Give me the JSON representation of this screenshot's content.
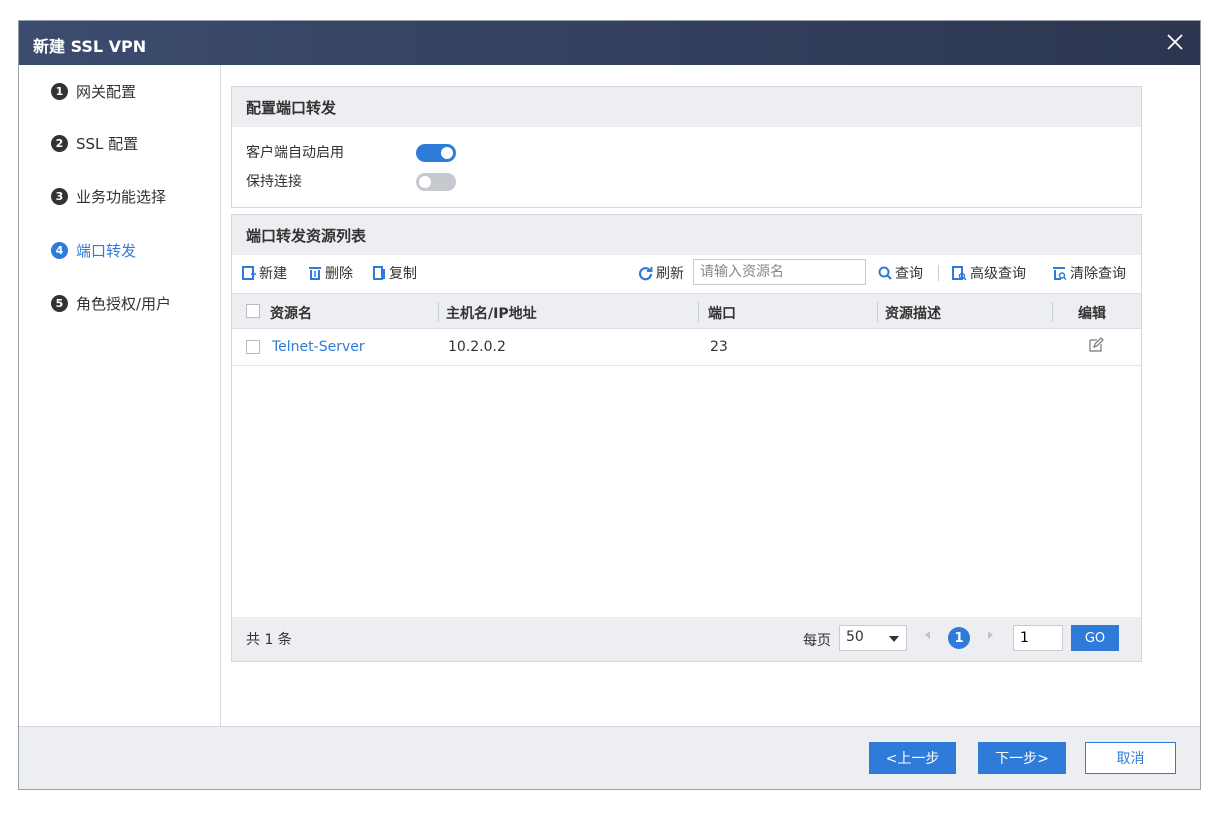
{
  "dialog": {
    "title": "新建 SSL VPN",
    "close_icon": "close-icon"
  },
  "sidebar": {
    "steps": [
      {
        "num": "1",
        "label": "网关配置"
      },
      {
        "num": "2",
        "label": "SSL 配置"
      },
      {
        "num": "3",
        "label": "业务功能选择"
      },
      {
        "num": "4",
        "label": "端口转发"
      },
      {
        "num": "5",
        "label": "角色授权/用户"
      }
    ],
    "active_step": 4
  },
  "config_panel": {
    "title": "配置端口转发",
    "options": [
      {
        "label": "客户端自动启用",
        "enabled": true
      },
      {
        "label": "保持连接",
        "enabled": false
      }
    ]
  },
  "list_panel": {
    "title": "端口转发资源列表",
    "toolbar": {
      "new_label": "新建",
      "delete_label": "删除",
      "copy_label": "复制",
      "refresh_label": "刷新",
      "search_placeholder": "请输入资源名",
      "query_label": "查询",
      "advanced_query_label": "高级查询",
      "clear_query_label": "清除查询"
    },
    "columns": [
      "资源名",
      "主机名/IP地址",
      "端口",
      "资源描述",
      "编辑"
    ],
    "rows": [
      {
        "name": "Telnet-Server",
        "host": "10.2.0.2",
        "port": "23",
        "description": ""
      }
    ],
    "pager": {
      "total_text": "共 1 条",
      "per_page_label": "每页",
      "per_page_value": "50",
      "current_page": "1",
      "page_input": "1",
      "go_label": "GO"
    }
  },
  "footer": {
    "prev_label": "<上一步",
    "next_label": "下一步>",
    "cancel_label": "取消"
  },
  "colors": {
    "accent": "#2f7bd9",
    "titlebar": "#343f5c",
    "panel_header": "#eceef1"
  }
}
